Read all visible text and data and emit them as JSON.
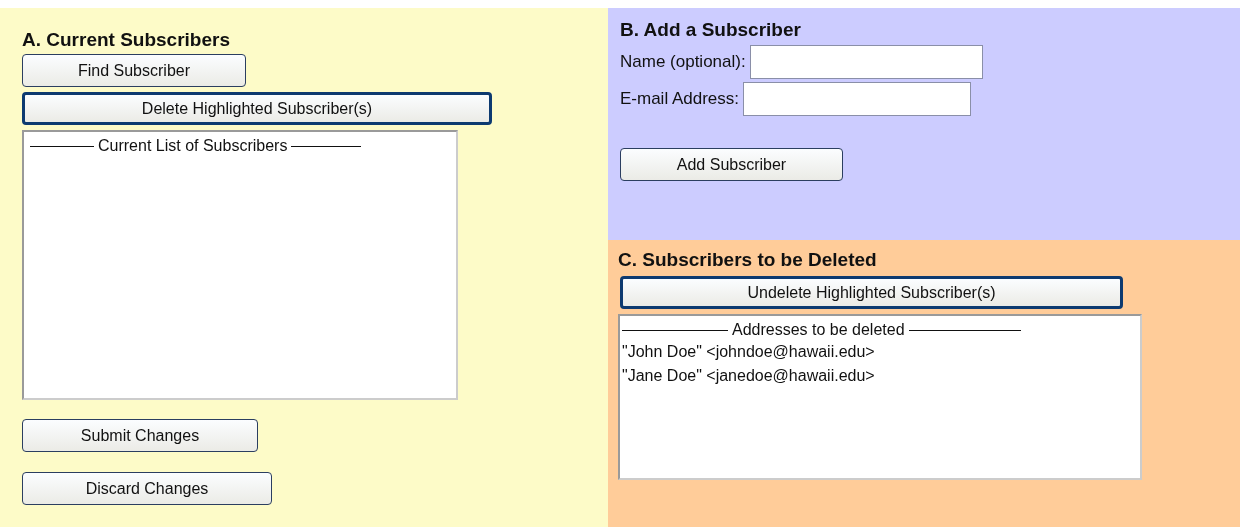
{
  "current_subscribers": {
    "title": "A. Current Subscribers",
    "top_buttons": [
      {
        "label": "Find Subscriber",
        "focused": false
      },
      {
        "label": "Delete Highlighted Subscriber(s)",
        "focused": true
      }
    ],
    "list": {
      "header": "Current List of Subscribers"
    },
    "bottom_buttons": [
      {
        "label": "Submit Changes",
        "focused": false
      },
      {
        "label": "Discard Changes",
        "focused": false
      }
    ]
  },
  "add_subscriber": {
    "title": "B. Add a Subscriber",
    "fields": [
      {
        "label": "Name (optional):"
      },
      {
        "label": "E-mail Address:"
      }
    ],
    "button": {
      "label": "Add Subscriber",
      "focused": false
    }
  },
  "to_be_deleted": {
    "title": "C. Subscribers to be Deleted",
    "button": {
      "label": "Undelete Highlighted Subscriber(s)",
      "focused": true
    },
    "list": {
      "header": "Addresses to be deleted",
      "items": [
        {
          "text": "\"John Doe\" <johndoe@hawaii.edu>"
        },
        {
          "text": "\"Jane Doe\" <janedoe@hawaii.edu>"
        }
      ]
    }
  }
}
